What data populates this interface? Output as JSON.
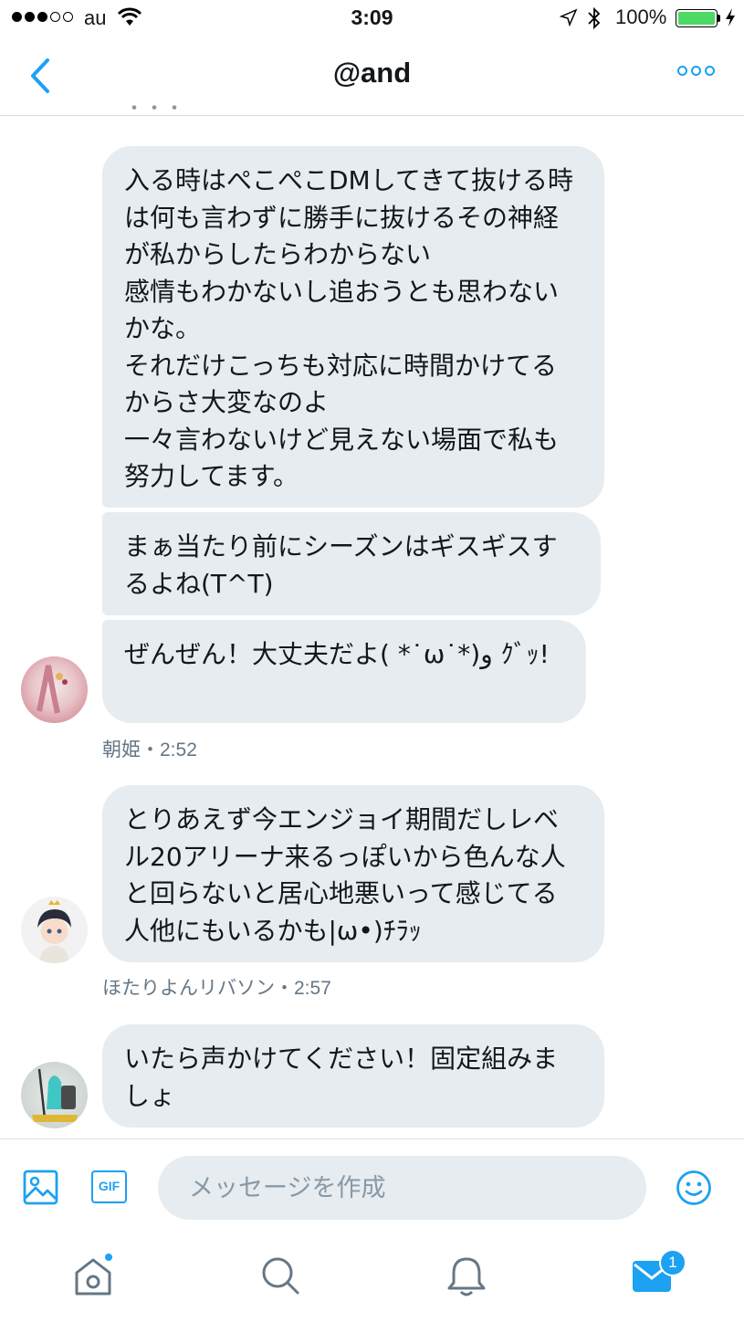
{
  "status_bar": {
    "carrier": "au",
    "time": "3:09",
    "battery_percent": "100%",
    "battery_level": 1.0,
    "signal_strength_dots": 3,
    "battery_color": "#4cd964"
  },
  "nav": {
    "title": "@and",
    "back_icon": "chevron-left-icon",
    "more_icon": "more-dots-icon"
  },
  "accent_color": "#1da1f2",
  "messages": [
    {
      "text": "入る時はぺこぺこDMしてきて抜ける時は何も言わずに勝手に抜けるその神経が私からしたらわからない\n感情もわかないし追おうとも思わないかな。\nそれだけこっちも対応に時間かけてるからさ大変なのよ\n一々言わないけど見えない場面で私も努力してます。"
    },
    {
      "text": "まぁ当たり前にシーズンはギスギスするよね(T^T)"
    },
    {
      "text": "ぜんぜん！大丈夫だよ( *˙ω˙*)و ｸﾞｯ!"
    },
    {
      "text": "とりあえず今エンジョイ期間だしレベル20アリーナ来るっぽいから色んな人と回らないと居心地悪いって感じてる人他にもいるかも|ω•)ﾁﾗｯ"
    },
    {
      "text": "いたら声かけてください！固定組みましょ"
    }
  ],
  "meta": [
    "朝姫・2:52",
    "ほたりよんリバソン・2:57"
  ],
  "composer": {
    "placeholder": "メッセージを作成",
    "gif_label": "GIF",
    "photo_icon": "image-icon",
    "emoji_icon": "emoji-icon"
  },
  "tabs": {
    "home_icon": "home-icon",
    "search_icon": "search-icon",
    "notifications_icon": "bell-icon",
    "messages_icon": "mail-icon",
    "messages_badge": "1"
  }
}
